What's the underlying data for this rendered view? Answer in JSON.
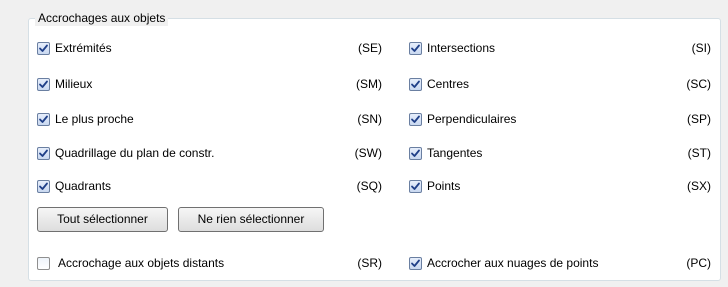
{
  "group_title": "Accrochages aux objets",
  "left_options": [
    {
      "label": "Extrémités",
      "code": "(SE)",
      "checked": true
    },
    {
      "label": "Milieux",
      "code": "(SM)",
      "checked": true
    },
    {
      "label": "Le plus proche",
      "code": "(SN)",
      "checked": true
    },
    {
      "label": "Quadrillage du plan de constr.",
      "code": "(SW)",
      "checked": true
    },
    {
      "label": "Quadrants",
      "code": "(SQ)",
      "checked": true
    }
  ],
  "right_options": [
    {
      "label": "Intersections",
      "code": "(SI)",
      "checked": true
    },
    {
      "label": "Centres",
      "code": "(SC)",
      "checked": true
    },
    {
      "label": "Perpendiculaires",
      "code": "(SP)",
      "checked": true
    },
    {
      "label": "Tangentes",
      "code": "(ST)",
      "checked": true
    },
    {
      "label": "Points",
      "code": "(SX)",
      "checked": true
    }
  ],
  "buttons": {
    "select_all": "Tout sélectionner",
    "select_none": "Ne rien sélectionner"
  },
  "bottom_options": {
    "distant": {
      "label": "Accrochage aux objets distants",
      "code": "(SR)",
      "checked": false
    },
    "point_clouds": {
      "label": "Accrocher aux nuages de points",
      "code": "(PC)",
      "checked": true
    }
  }
}
